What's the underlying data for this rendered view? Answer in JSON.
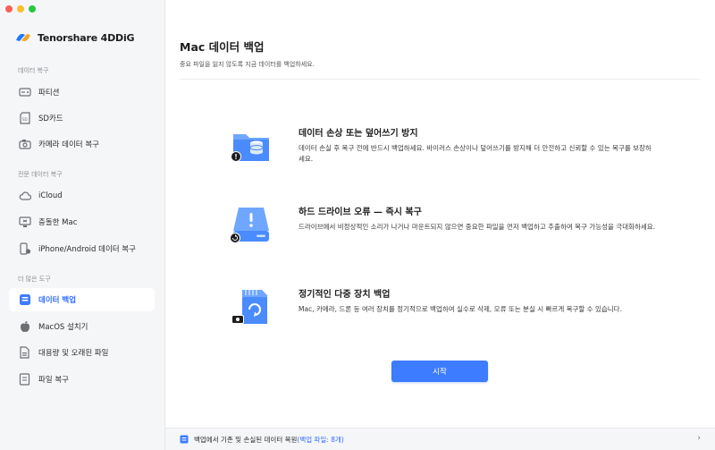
{
  "app": {
    "name": "Tenorshare 4DDiG"
  },
  "sidebar": {
    "sections": [
      {
        "title": "데이터 복구"
      },
      {
        "title": "전문 데이터 복구"
      },
      {
        "title": "더 많은 도구"
      }
    ],
    "items": [
      {
        "label": "파티션",
        "icon": "drive-icon"
      },
      {
        "label": "SD카드",
        "icon": "sd-card-icon"
      },
      {
        "label": "카메라 데이터 복구",
        "icon": "camera-icon"
      },
      {
        "label": "iCloud",
        "icon": "cloud-icon"
      },
      {
        "label": "충돌한 Mac",
        "icon": "crashed-mac-icon"
      },
      {
        "label": "iPhone/Android 데이터 복구",
        "icon": "phone-recovery-icon"
      },
      {
        "label": "데이터 백업",
        "icon": "backup-icon",
        "active": true
      },
      {
        "label": "MacOS 설치기",
        "icon": "apple-icon"
      },
      {
        "label": "대용량 및 오래된 파일",
        "icon": "large-files-icon"
      },
      {
        "label": "파일 복구",
        "icon": "file-repair-icon"
      }
    ]
  },
  "main": {
    "title": "Mac 데이터 백업",
    "subtitle": "중요 파일을 잃지 않도록 지금 데이터를 백업하세요.",
    "features": [
      {
        "title": "데이터 손상 또는 덮어쓰기 방지",
        "description": "데이터 손실 후 복구 전에 반드시 백업하세요.  바이러스 손상이나 덮어쓰기를 방지해 더 안전하고 신뢰할 수 있는 복구를 보장하세요.",
        "icon": "folder-database-icon"
      },
      {
        "title": "하드 드라이브 오류 — 즉시 복구",
        "description": "드라이브에서 비정상적인 소리가 나거나 마운트되지 않으면 중요한 파일을 먼저 백업하고 추출하여 복구 가능성을 극대화하세요.",
        "icon": "hard-drive-warning-icon"
      },
      {
        "title": "정기적인 다중 장치 백업",
        "description": "Mac, 카메라, 드론 등 여러 장치를 정기적으로 백업하여 실수로 삭제, 오류 또는 분실 시 빠르게 복구할 수 있습니다.",
        "icon": "multi-device-sync-icon"
      }
    ],
    "start_button": "시작"
  },
  "bottom_bar": {
    "text": "백업에서 기존 및 손실된 데이터 복원",
    "highlight": "(백업 파일: 8개)",
    "chevron": "›"
  },
  "colors": {
    "accent": "#3d7bff",
    "sidebar_bg": "#f5f6f8",
    "active_text": "#2f6bff"
  }
}
